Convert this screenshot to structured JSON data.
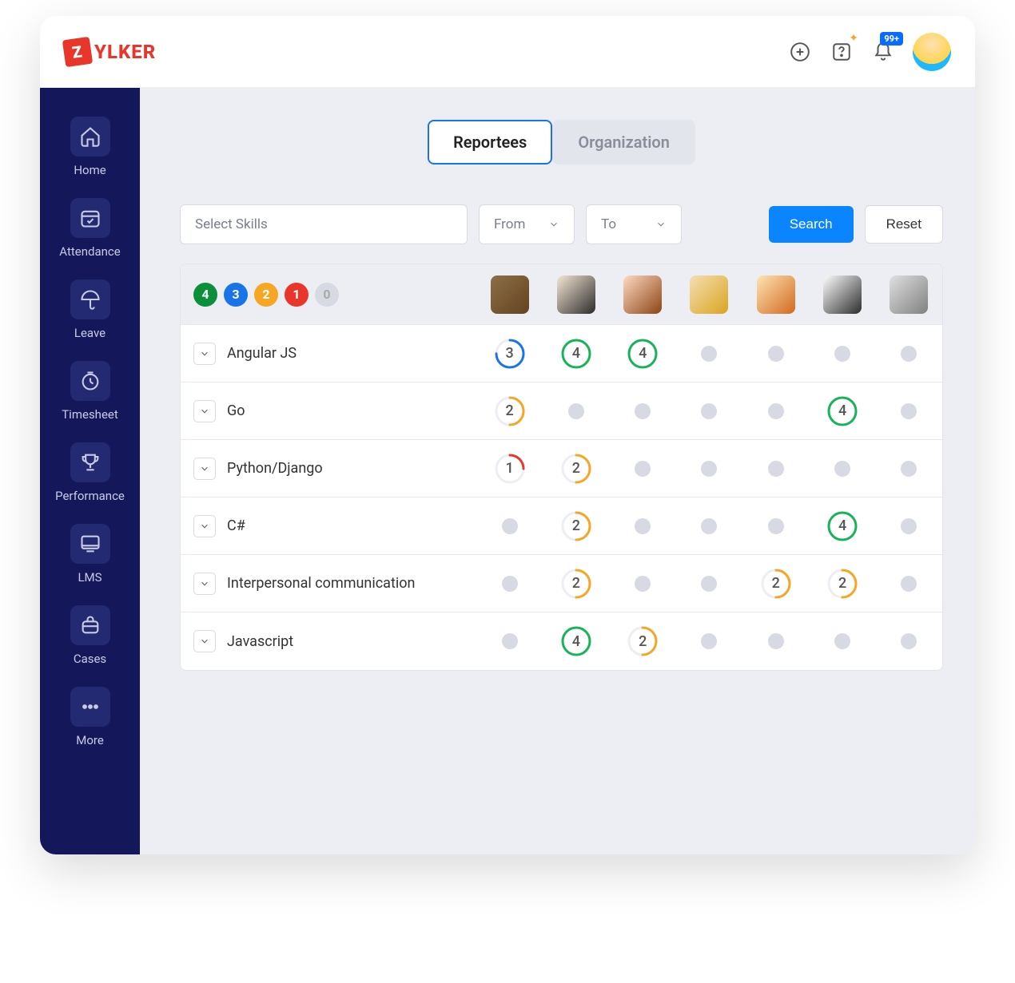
{
  "brand": {
    "name": "ZYLKER",
    "initial": "Z",
    "rest": "YLKER"
  },
  "topbar": {
    "notification_badge": "99+"
  },
  "sidebar": {
    "items": [
      {
        "label": "Home",
        "icon": "home"
      },
      {
        "label": "Attendance",
        "icon": "calendar"
      },
      {
        "label": "Leave",
        "icon": "umbrella"
      },
      {
        "label": "Timesheet",
        "icon": "clock"
      },
      {
        "label": "Performance",
        "icon": "trophy"
      },
      {
        "label": "LMS",
        "icon": "monitor"
      },
      {
        "label": "Cases",
        "icon": "briefcase"
      },
      {
        "label": "More",
        "icon": "dots"
      }
    ]
  },
  "tabs": {
    "active": "Reportees",
    "inactive": "Organization"
  },
  "filters": {
    "skills_placeholder": "Select Skills",
    "from_label": "From",
    "to_label": "To",
    "search_label": "Search",
    "reset_label": "Reset"
  },
  "legend": [
    "4",
    "3",
    "2",
    "1",
    "0"
  ],
  "legend_colors": {
    "4": "#0a8f3a",
    "3": "#1a73e8",
    "2": "#f5a623",
    "1": "#e8362b",
    "0": "#d8dae3"
  },
  "skills": [
    {
      "name": "Angular JS",
      "scores": [
        3,
        4,
        4,
        null,
        null,
        null,
        null
      ]
    },
    {
      "name": "Go",
      "scores": [
        2,
        null,
        null,
        null,
        null,
        4,
        null
      ]
    },
    {
      "name": "Python/Django",
      "scores": [
        1,
        2,
        null,
        null,
        null,
        null,
        null
      ]
    },
    {
      "name": "C#",
      "scores": [
        null,
        2,
        null,
        null,
        null,
        4,
        null
      ]
    },
    {
      "name": "Interpersonal communication",
      "scores": [
        null,
        2,
        null,
        null,
        2,
        2,
        null
      ]
    },
    {
      "name": "Javascript",
      "scores": [
        null,
        4,
        2,
        null,
        null,
        null,
        null
      ]
    }
  ],
  "score_colors": {
    "1": "#e8362b",
    "2": "#f5a623",
    "3": "#1a73e8",
    "4": "#17b457"
  }
}
